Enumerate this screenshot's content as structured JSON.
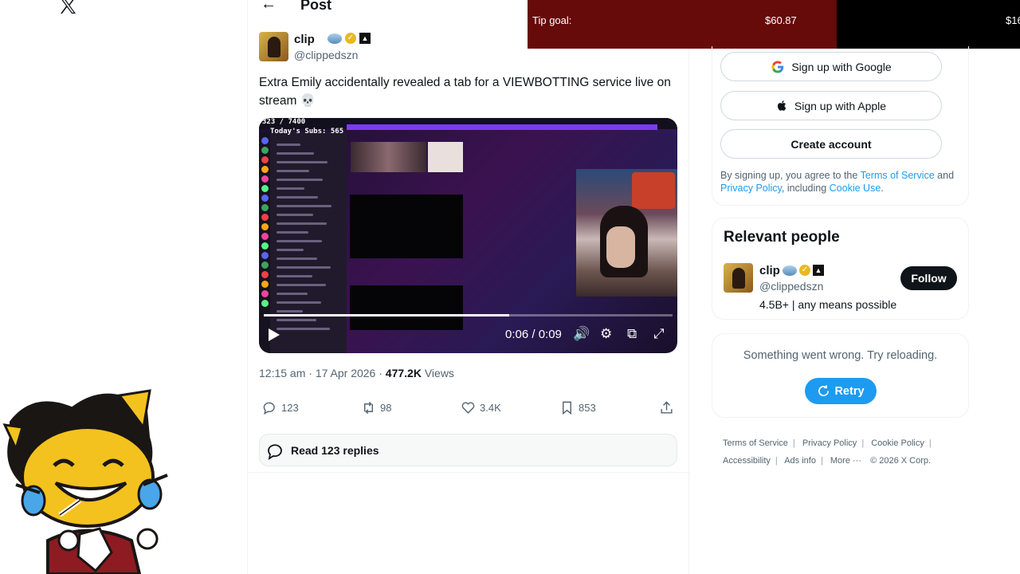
{
  "post_header": {
    "title": "Post"
  },
  "author": {
    "name": "clip",
    "handle": "@clippedszn"
  },
  "tweet": {
    "text": "Extra Emily accidentally revealed a tab for a VIEWBOTTING service live on stream 💀"
  },
  "video": {
    "overlay_count": "323 / 7400",
    "overlay_subs": "Today's Subs: 565",
    "time": "0:06 / 0:09",
    "progress": 0.6
  },
  "meta": {
    "time": "12:15 am",
    "date": "17 Apr 2026",
    "views_count": "477.2K",
    "views_label": "Views"
  },
  "actions": {
    "replies": "123",
    "reposts": "98",
    "likes": "3.4K",
    "bookmarks": "853"
  },
  "read_replies": "Read 123 replies",
  "tip_overlay": {
    "label": "Tip goal:",
    "amount": "$60.87",
    "amount_cut": "$16"
  },
  "signup": {
    "google": "Sign up with Google",
    "apple": "Sign up with Apple",
    "create": "Create account",
    "legal_prefix": "By signing up, you agree to the",
    "terms": "Terms of Service",
    "and": "and",
    "privacy": "Privacy Policy",
    "including": ", including",
    "cookie": "Cookie Use",
    "period": "."
  },
  "relevant_people": {
    "title": "Relevant people",
    "name": "clip",
    "handle": "@clippedszn",
    "bio": "4.5B+ | any means possible",
    "follow": "Follow"
  },
  "trends_error": {
    "message": "Something went wrong. Try reloading.",
    "retry": "Retry"
  },
  "footer": {
    "terms": "Terms of Service",
    "privacy": "Privacy Policy",
    "cookie": "Cookie Policy",
    "accessibility": "Accessibility",
    "ads": "Ads info",
    "more": "More ···",
    "copyright": "© 2026 X Corp."
  },
  "colors": {
    "accent": "#1d9bf0",
    "tip_bar": "#660a0a",
    "text_secondary": "#536471"
  }
}
